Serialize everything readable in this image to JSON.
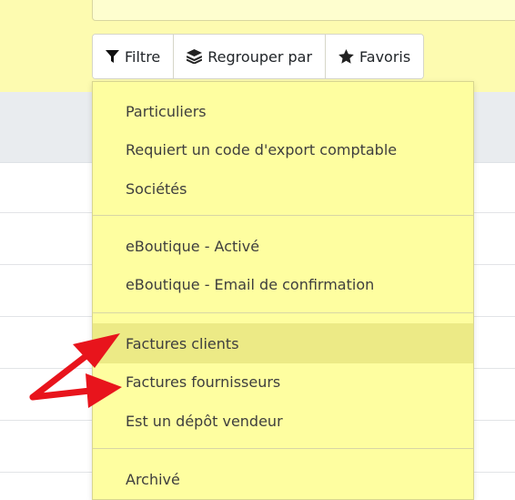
{
  "toolbar": {
    "filter_label": "Filtre",
    "groupby_label": "Regrouper par",
    "favorites_label": "Favoris"
  },
  "filter_menu": {
    "groups": [
      [
        "Particuliers",
        "Requiert un code d'export comptable",
        "Sociétés"
      ],
      [
        "eBoutique - Activé",
        "eBoutique - Email de confirmation"
      ],
      [
        "Factures clients",
        "Factures fournisseurs",
        "Est un dépôt vendeur"
      ],
      [
        "Archivé"
      ]
    ],
    "hovered_item": "Factures clients"
  },
  "annotation": {
    "arrow_color": "#e8141c"
  },
  "colors": {
    "top_bar": "#fdfbb0",
    "menu_bg": "#fefea0",
    "menu_hover": "#ecea86"
  }
}
